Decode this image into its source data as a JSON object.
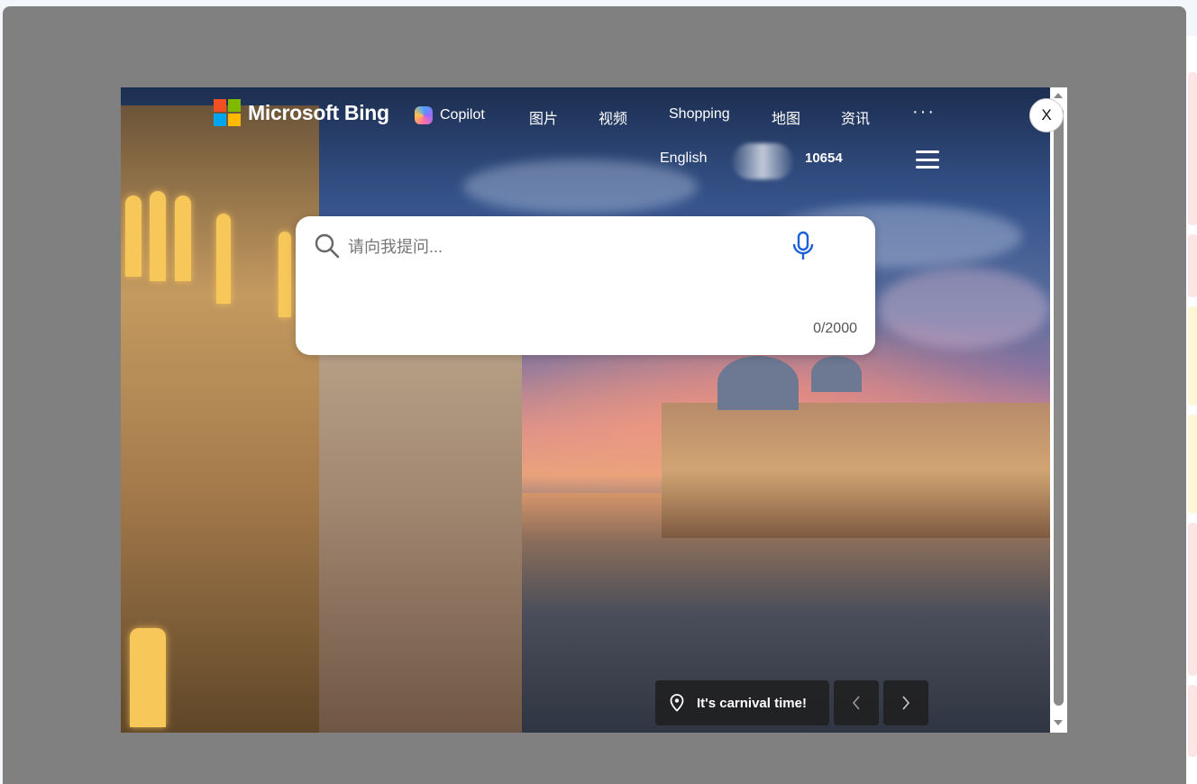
{
  "brand": {
    "name": "Microsoft Bing",
    "logo_colors": [
      "#f25022",
      "#7fba00",
      "#00a4ef",
      "#ffb900"
    ]
  },
  "nav": {
    "items": [
      {
        "label": "Copilot",
        "icon": "copilot-icon"
      },
      {
        "label": "图片"
      },
      {
        "label": "视频"
      },
      {
        "label": "Shopping"
      },
      {
        "label": "地图"
      },
      {
        "label": "资讯"
      }
    ],
    "more_label": "···"
  },
  "header": {
    "language": "English",
    "rewards_points": "10654"
  },
  "search": {
    "placeholder": "请向我提问...",
    "value": "",
    "char_count": "0/2000"
  },
  "background": {
    "caption": "It's carnival time!",
    "prev_icon": "chevron-left-icon",
    "next_icon": "chevron-right-icon"
  },
  "dialog": {
    "close_label": "X"
  },
  "colors": {
    "overlay": "#808080",
    "mic_blue": "#1a5fd6"
  }
}
